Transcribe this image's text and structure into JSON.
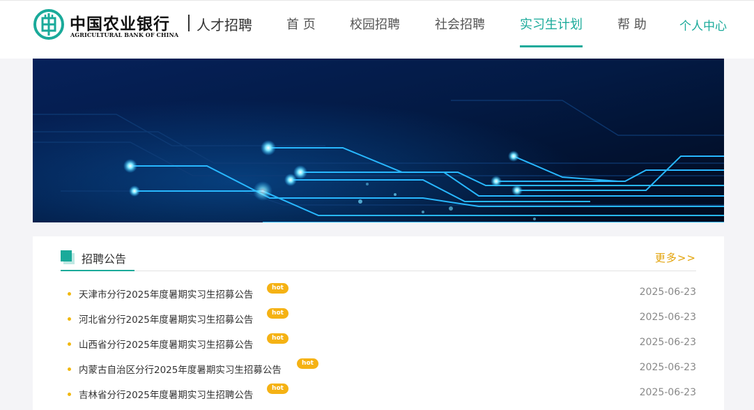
{
  "header": {
    "logo_cn": "中国农业银行",
    "logo_en": "AGRICULTURAL BANK OF CHINA",
    "logo_sub": "人才招聘",
    "nav": [
      {
        "label": "首 页",
        "active": false
      },
      {
        "label": "校园招聘",
        "active": false
      },
      {
        "label": "社会招聘",
        "active": false
      },
      {
        "label": "实习生计划",
        "active": true
      },
      {
        "label": "帮 助",
        "active": false
      }
    ],
    "user_center": "个人中心",
    "accent": "#1aaa9a",
    "logo_icon": "abc-emblem-icon"
  },
  "section": {
    "title": "招聘公告",
    "more": "更多>>",
    "hot_label": "hot",
    "items": [
      {
        "title": "天津市分行2025年度暑期实习生招募公告",
        "date": "2025-06-23",
        "hot": true
      },
      {
        "title": "河北省分行2025年度暑期实习生招募公告",
        "date": "2025-06-23",
        "hot": true
      },
      {
        "title": "山西省分行2025年度暑期实习生招募公告",
        "date": "2025-06-23",
        "hot": true
      },
      {
        "title": "内蒙古自治区分行2025年度暑期实习生招募公告",
        "date": "2025-06-23",
        "hot": true
      },
      {
        "title": "吉林省分行2025年度暑期实习生招聘公告",
        "date": "2025-06-23",
        "hot": true
      }
    ]
  }
}
